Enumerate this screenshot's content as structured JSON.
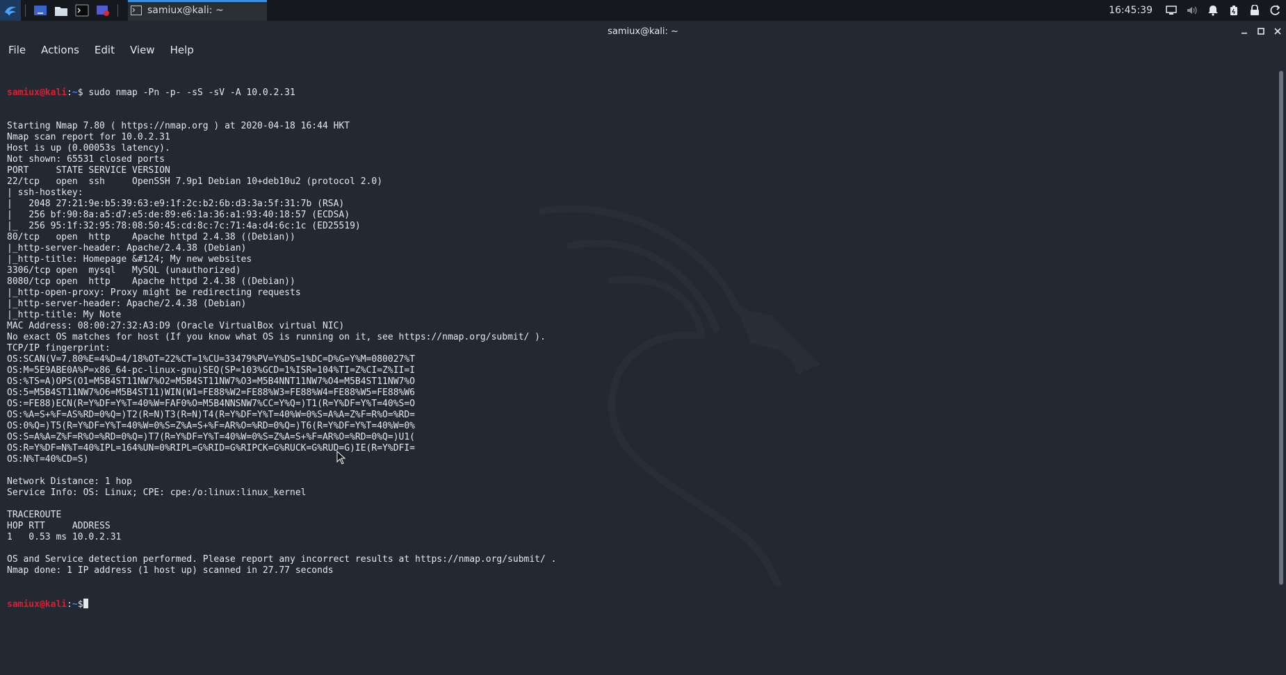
{
  "panel": {
    "launcher_icon": "kali-menu-icon",
    "apps": [
      "workspace-switcher-icon",
      "file-manager-icon",
      "terminal-icon",
      "text-editor-icon"
    ],
    "task": {
      "label": "samiux@kali: ~"
    },
    "clock": "16:45:39",
    "tray_icons": [
      "display-icon",
      "volume-icon",
      "notification-bell-icon",
      "power-manager-icon",
      "lock-icon",
      "logout-icon"
    ]
  },
  "window": {
    "title": "samiux@kali: ~"
  },
  "menu": [
    "File",
    "Actions",
    "Edit",
    "View",
    "Help"
  ],
  "terminal": {
    "prompt": {
      "user": "samiux@kali",
      "sep": ":",
      "path": "~",
      "symbol": "$"
    },
    "command": " sudo nmap -Pn -p- -sS -sV -A 10.0.2.31",
    "output": [
      "Starting Nmap 7.80 ( https://nmap.org ) at 2020-04-18 16:44 HKT",
      "Nmap scan report for 10.0.2.31",
      "Host is up (0.00053s latency).",
      "Not shown: 65531 closed ports",
      "PORT     STATE SERVICE VERSION",
      "22/tcp   open  ssh     OpenSSH 7.9p1 Debian 10+deb10u2 (protocol 2.0)",
      "| ssh-hostkey: ",
      "|   2048 27:21:9e:b5:39:63:e9:1f:2c:b2:6b:d3:3a:5f:31:7b (RSA)",
      "|   256 bf:90:8a:a5:d7:e5:de:89:e6:1a:36:a1:93:40:18:57 (ECDSA)",
      "|_  256 95:1f:32:95:78:08:50:45:cd:8c:7c:71:4a:d4:6c:1c (ED25519)",
      "80/tcp   open  http    Apache httpd 2.4.38 ((Debian))",
      "|_http-server-header: Apache/2.4.38 (Debian)",
      "|_http-title: Homepage &#124; My new websites",
      "3306/tcp open  mysql   MySQL (unauthorized)",
      "8080/tcp open  http    Apache httpd 2.4.38 ((Debian))",
      "|_http-open-proxy: Proxy might be redirecting requests",
      "|_http-server-header: Apache/2.4.38 (Debian)",
      "|_http-title: My Note",
      "MAC Address: 08:00:27:32:A3:D9 (Oracle VirtualBox virtual NIC)",
      "No exact OS matches for host (If you know what OS is running on it, see https://nmap.org/submit/ ).",
      "TCP/IP fingerprint:",
      "OS:SCAN(V=7.80%E=4%D=4/18%OT=22%CT=1%CU=33479%PV=Y%DS=1%DC=D%G=Y%M=080027%T",
      "OS:M=5E9ABE0A%P=x86_64-pc-linux-gnu)SEQ(SP=103%GCD=1%ISR=104%TI=Z%CI=Z%II=I",
      "OS:%TS=A)OPS(O1=M5B4ST11NW7%O2=M5B4ST11NW7%O3=M5B4NNT11NW7%O4=M5B4ST11NW7%O",
      "OS:5=M5B4ST11NW7%O6=M5B4ST11)WIN(W1=FE88%W2=FE88%W3=FE88%W4=FE88%W5=FE88%W6",
      "OS:=FE88)ECN(R=Y%DF=Y%T=40%W=FAF0%O=M5B4NNSNW7%CC=Y%Q=)T1(R=Y%DF=Y%T=40%S=O",
      "OS:%A=S+%F=AS%RD=0%Q=)T2(R=N)T3(R=N)T4(R=Y%DF=Y%T=40%W=0%S=A%A=Z%F=R%O=%RD=",
      "OS:0%Q=)T5(R=Y%DF=Y%T=40%W=0%S=Z%A=S+%F=AR%O=%RD=0%Q=)T6(R=Y%DF=Y%T=40%W=0%",
      "OS:S=A%A=Z%F=R%O=%RD=0%Q=)T7(R=Y%DF=Y%T=40%W=0%S=Z%A=S+%F=AR%O=%RD=0%Q=)U1(",
      "OS:R=Y%DF=N%T=40%IPL=164%UN=0%RIPL=G%RID=G%RIPCK=G%RUCK=G%RUD=G)IE(R=Y%DFI=",
      "OS:N%T=40%CD=S)",
      "",
      "Network Distance: 1 hop",
      "Service Info: OS: Linux; CPE: cpe:/o:linux:linux_kernel",
      "",
      "TRACEROUTE",
      "HOP RTT     ADDRESS",
      "1   0.53 ms 10.0.2.31",
      "",
      "OS and Service detection performed. Please report any incorrect results at https://nmap.org/submit/ .",
      "Nmap done: 1 IP address (1 host up) scanned in 27.77 seconds"
    ],
    "final_prompt_command": ""
  },
  "colors": {
    "background": "#232933",
    "panel": "#15181c",
    "prompt_user": "#e01e2e",
    "prompt_path": "#3b82f6",
    "text": "#e6e8eb",
    "accent": "#3d8fe0"
  }
}
